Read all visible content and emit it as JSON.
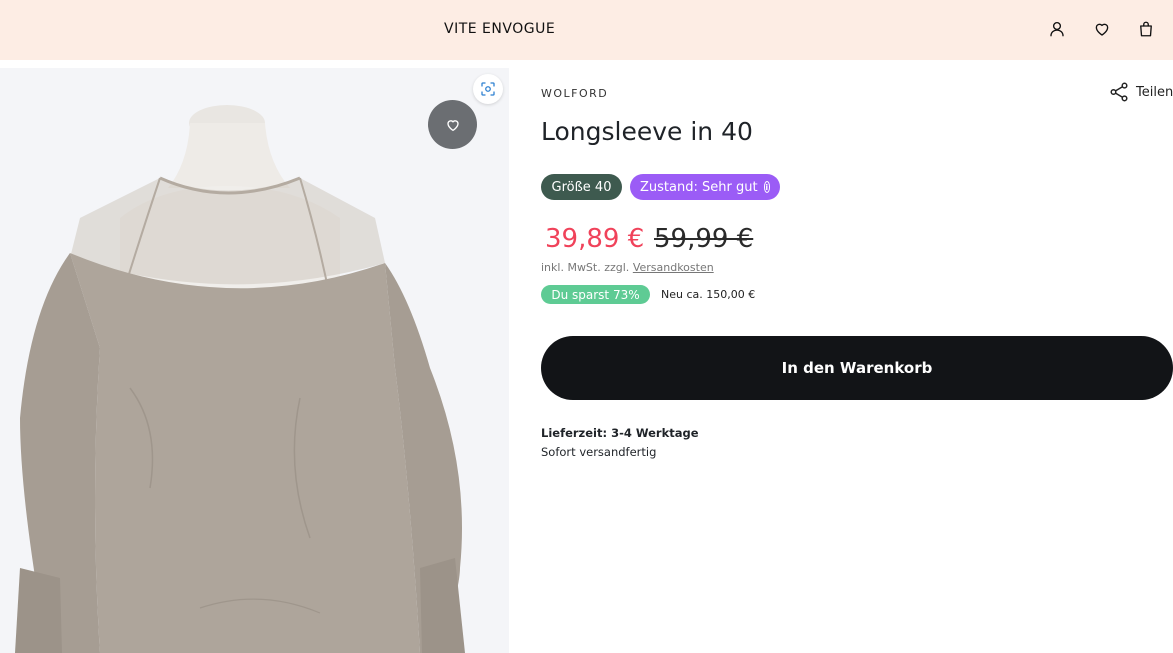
{
  "header": {
    "logo": "VITE ENVOGUE",
    "icons": [
      "account-icon",
      "wishlist-heart-icon",
      "shopping-bag-icon"
    ]
  },
  "gallery": {
    "zoom_icon": "zoom-scan-icon",
    "wishlist_icon": "heart-icon"
  },
  "product": {
    "brand": "WOLFORD",
    "title": "Longsleeve in 40",
    "share_label": "Teilen",
    "size_badge": "Größe 40",
    "condition_badge": "Zustand: Sehr gut",
    "price_current": "39,89 €",
    "price_original": "59,99 €",
    "tax_text": "inkl. MwSt. zzgl.",
    "shipping_link": "Versandkosten",
    "savings_badge": "Du sparst 73%",
    "new_price_text": "Neu ca. 150,00 €",
    "add_to_cart": "In den Warenkorb",
    "delivery_time": "Lieferzeit: 3-4 Werktage",
    "delivery_status": "Sofort versandfertig"
  },
  "colors": {
    "header_bg": "#fdede4",
    "price_sale": "#f0425a",
    "size_badge": "#3e5a4f",
    "condition_badge": "#9b5cf6",
    "savings_badge": "#5ecb94",
    "cart_button": "#121417"
  }
}
